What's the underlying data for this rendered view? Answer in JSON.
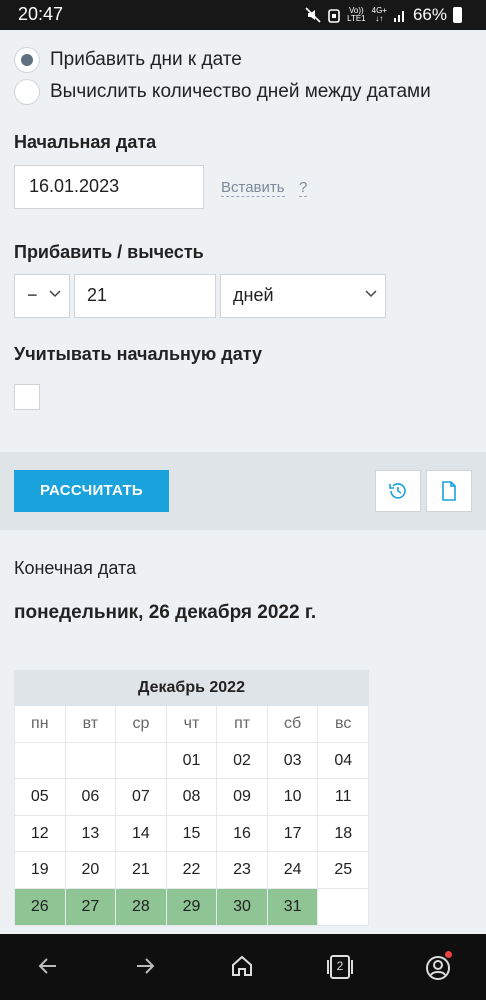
{
  "status_bar": {
    "time": "20:47",
    "net_top": "Vo))",
    "net_bottom": "LTE1",
    "net2_top": "4G+",
    "net2_bottom": "↓↑",
    "battery": "66%"
  },
  "form": {
    "mode_options": [
      {
        "label": "Прибавить дни к дате",
        "selected": true
      },
      {
        "label": "Вычислить количество дней между датами",
        "selected": false
      }
    ],
    "start_date_label": "Начальная дата",
    "start_date_value": "16.01.2023",
    "paste_link": "Вставить",
    "help_link": "?",
    "add_subtract_label": "Прибавить / вычесть",
    "sign_value": "−",
    "amount_value": "21",
    "unit_value": "дней",
    "include_start_label": "Учитывать начальную дату",
    "include_start_checked": false
  },
  "actions": {
    "calculate_label": "РАССЧИТАТЬ",
    "accent_color": "#1aa2dc"
  },
  "result": {
    "label": "Конечная дата",
    "value": "понедельник, 26 декабря 2022 г."
  },
  "calendar": {
    "month_title": "Декабрь 2022",
    "weekdays": [
      "пн",
      "вт",
      "ср",
      "чт",
      "пт",
      "сб",
      "вс"
    ],
    "days": [
      "",
      "",
      "",
      "01",
      "02",
      "03",
      "04",
      "05",
      "06",
      "07",
      "08",
      "09",
      "10",
      "11",
      "12",
      "13",
      "14",
      "15",
      "16",
      "17",
      "18",
      "19",
      "20",
      "21",
      "22",
      "23",
      "24",
      "25",
      "26",
      "27",
      "28",
      "29",
      "30",
      "31",
      ""
    ],
    "highlighted": [
      "26",
      "27",
      "28",
      "29",
      "30",
      "31"
    ],
    "highlight_color": "#8fc495"
  },
  "nav_bar": {
    "tabs_count": "2"
  }
}
